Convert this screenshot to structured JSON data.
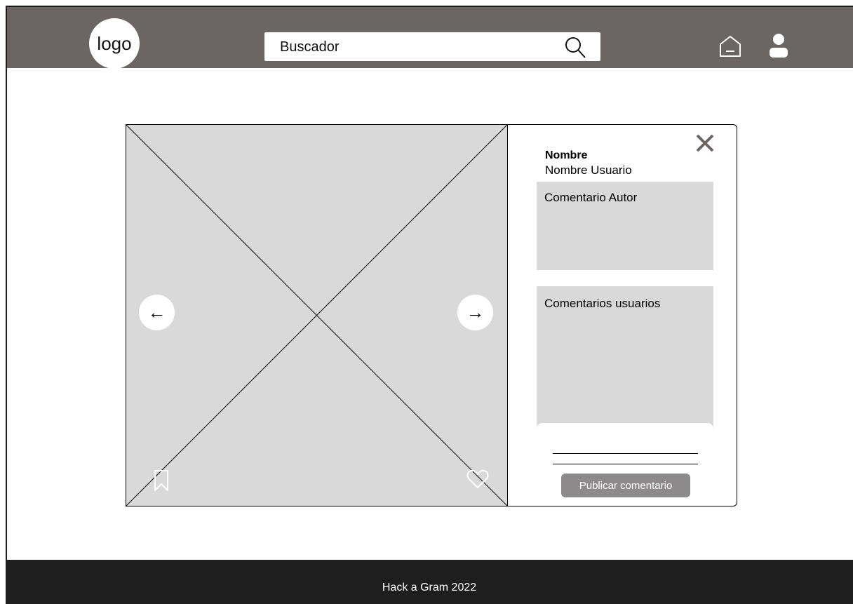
{
  "header": {
    "logo_text": "logo",
    "search_placeholder": "Buscador",
    "icons": [
      "search-icon",
      "home-icon",
      "user-icon"
    ],
    "background": "#6b6664"
  },
  "post": {
    "image_placeholder": "image",
    "prev_arrow": "←",
    "next_arrow": "→",
    "icons": [
      "bookmark-icon",
      "heart-icon",
      "close-icon"
    ]
  },
  "sidebar": {
    "name_label": "Nombre",
    "username": "Nombre Usuario",
    "author_comment": "Comentario Autor",
    "users_comments": "Comentarios usuarios",
    "publish_button": "Publicar comentario"
  },
  "footer": {
    "text": "Hack a Gram 2022",
    "background": "#1e1e1e"
  }
}
